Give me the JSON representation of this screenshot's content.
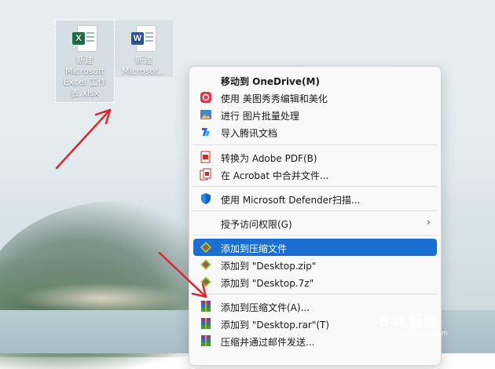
{
  "desktop": {
    "icons": [
      {
        "label": "新建 Microsoft Excel 工作表.xlsx",
        "type": "excel",
        "badge": "X",
        "color": "#1d7144"
      },
      {
        "label": "新建 Microsof...",
        "type": "word",
        "badge": "W",
        "color": "#2b579a"
      }
    ]
  },
  "context_menu": {
    "items": [
      {
        "label": "移动到 OneDrive(M)",
        "icon": "onedrive-icon",
        "bold": true
      },
      {
        "label": "使用 美图秀秀编辑和美化",
        "icon": "meitu-icon"
      },
      {
        "label": "进行 图片批量处理",
        "icon": "image-batch-icon"
      },
      {
        "label": "导入腾讯文档",
        "icon": "tencent-docs-icon"
      },
      {
        "label": "转换为 Adobe PDF(B)",
        "icon": "adobe-pdf-icon"
      },
      {
        "label": "在 Acrobat 中合并文件...",
        "icon": "acrobat-merge-icon"
      },
      {
        "label": "使用 Microsoft Defender扫描...",
        "icon": "defender-shield-icon"
      },
      {
        "label": "授予访问权限(G)",
        "icon": "",
        "submenu": true
      },
      {
        "label": "添加到压缩文件",
        "icon": "zip-archive-icon",
        "highlighted": true
      },
      {
        "label": "添加到 \"Desktop.zip\"",
        "icon": "zip-archive-icon"
      },
      {
        "label": "添加到 \"Desktop.7z\"",
        "icon": "zip-archive-icon"
      },
      {
        "label": "添加到压缩文件(A)...",
        "icon": "winrar-icon"
      },
      {
        "label": "添加到 \"Desktop.rar\"(T)",
        "icon": "winrar-icon"
      },
      {
        "label": "压缩并通过邮件发送...",
        "icon": "winrar-icon"
      }
    ],
    "submenu_glyph": "›"
  },
  "watermark": {
    "main": "Bai 经验",
    "sub": "jingyan.baidu.com"
  },
  "colors": {
    "highlight": "#1b6fd1",
    "arrow": "#e0252b"
  }
}
